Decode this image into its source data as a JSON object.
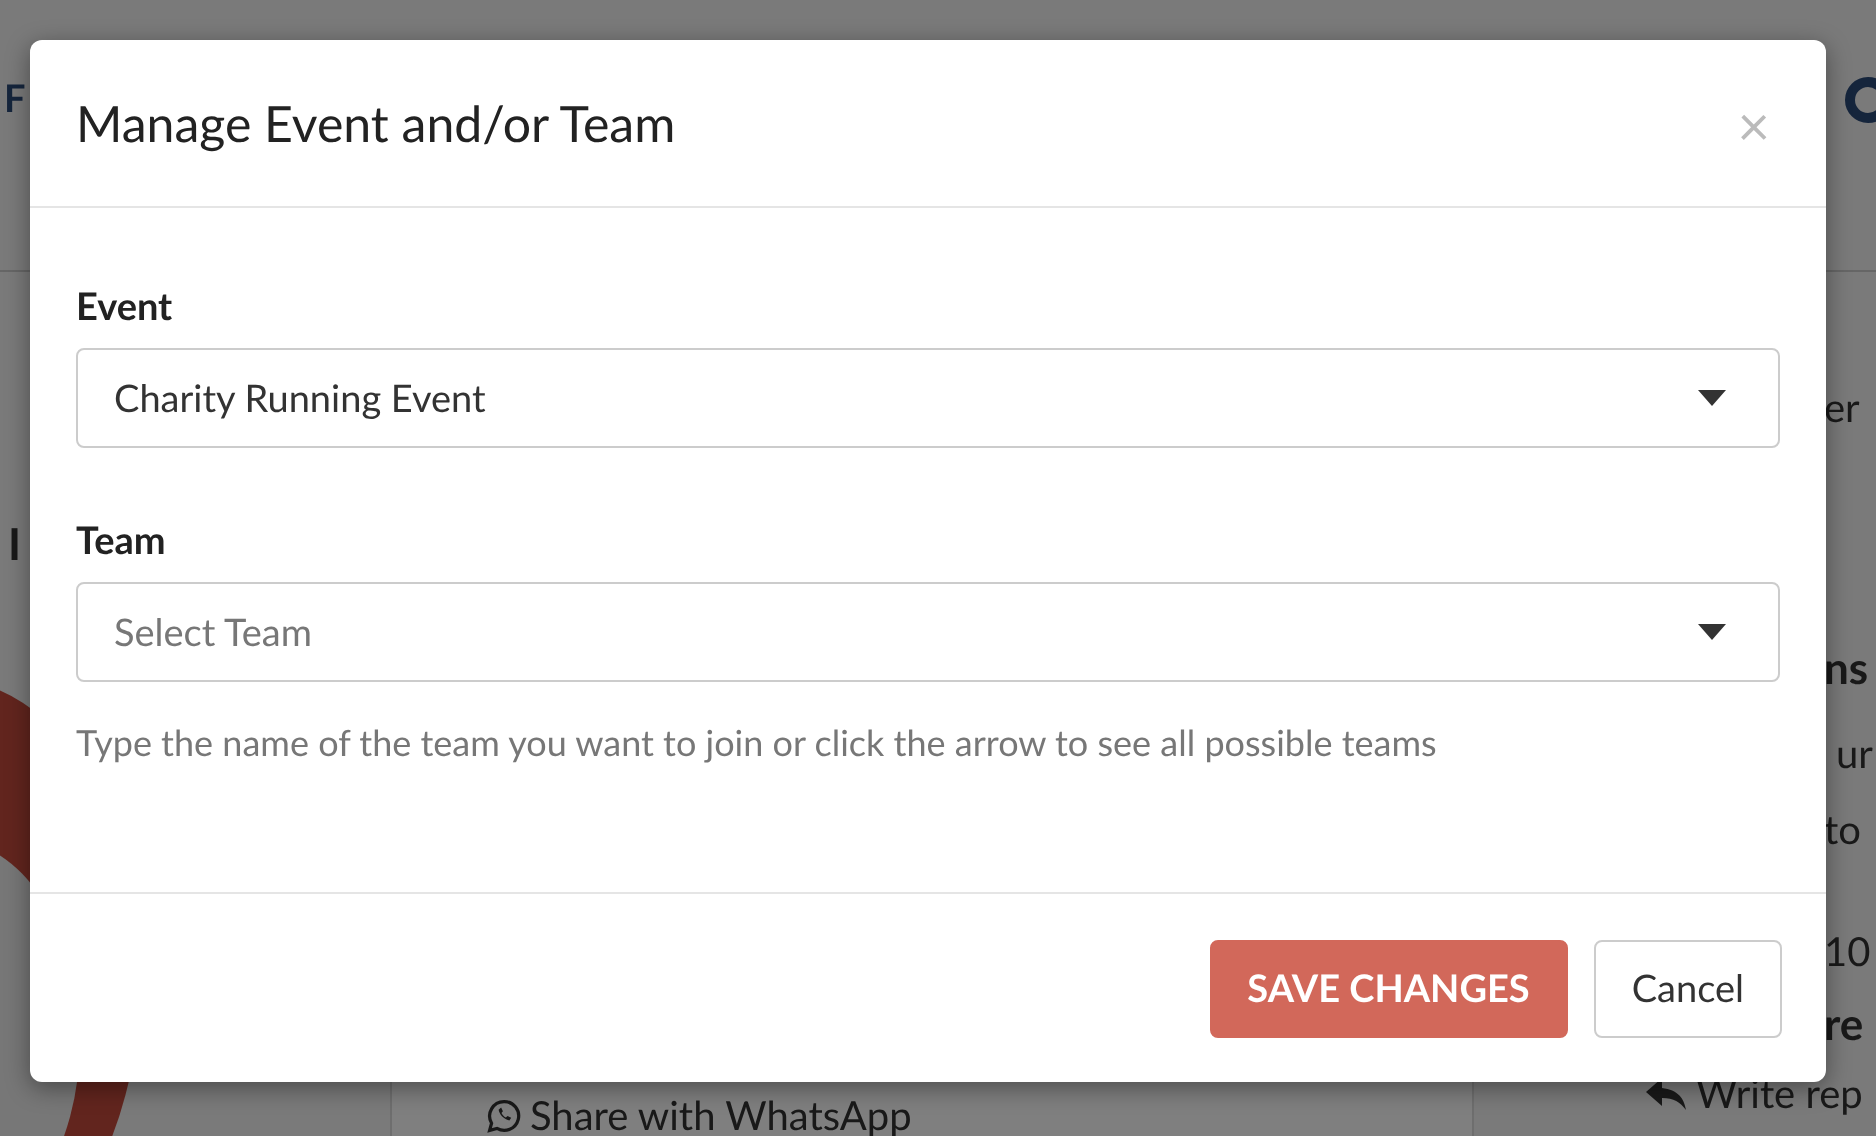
{
  "background": {
    "fragments": [
      {
        "kind": "nav",
        "text": "F"
      },
      {
        "kind": "heading",
        "text": "I"
      },
      {
        "kind": "text",
        "text": "er"
      },
      {
        "kind": "heading",
        "text": "ns"
      },
      {
        "kind": "text",
        "text": "ur"
      },
      {
        "kind": "text",
        "text": "to"
      },
      {
        "kind": "text",
        "text": "10"
      },
      {
        "kind": "heading",
        "text": "re"
      },
      {
        "kind": "reply",
        "text": "Write rep"
      },
      {
        "kind": "whatsapp",
        "text": "Share with WhatsApp"
      }
    ]
  },
  "modal": {
    "title": "Manage Event and/or Team",
    "close": "×",
    "fields": [
      {
        "label": "Event",
        "value": "Charity Running Event"
      },
      {
        "label": "Team",
        "placeholder": "Select Team",
        "help": "Type the name of the team you want to join or click the arrow to see all possible teams"
      }
    ],
    "buttons": [
      {
        "label": "SAVE CHANGES",
        "kind": "primary"
      },
      {
        "label": "Cancel",
        "kind": "default"
      }
    ]
  }
}
